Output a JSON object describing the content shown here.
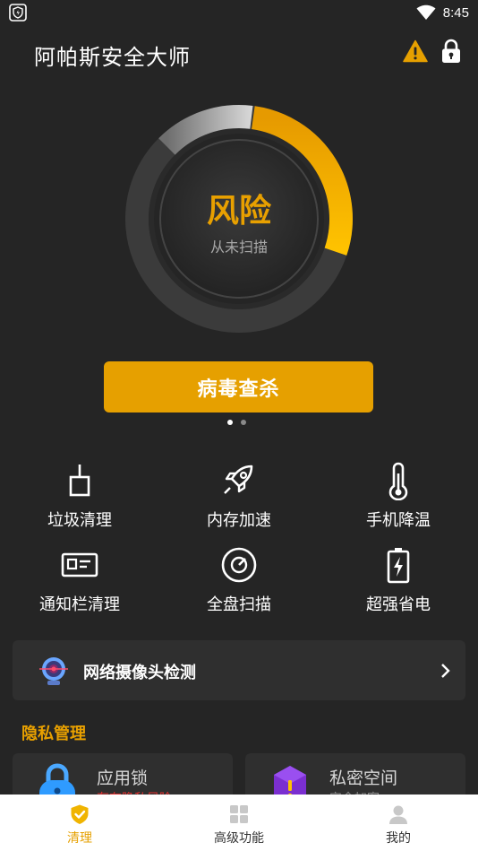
{
  "status_bar": {
    "time": "8:45"
  },
  "header": {
    "title": "阿帕斯安全大师"
  },
  "ring": {
    "status": "风险",
    "subtitle": "从未扫描",
    "risk_fraction": 0.28
  },
  "scan_button": {
    "label": "病毒查杀"
  },
  "features": [
    {
      "label": "垃圾清理",
      "icon": "brush-icon"
    },
    {
      "label": "内存加速",
      "icon": "rocket-icon"
    },
    {
      "label": "手机降温",
      "icon": "thermometer-icon"
    },
    {
      "label": "通知栏清理",
      "icon": "notification-card-icon"
    },
    {
      "label": "全盘扫描",
      "icon": "disk-scan-icon"
    },
    {
      "label": "超强省电",
      "icon": "battery-bolt-icon"
    }
  ],
  "camera_card": {
    "label": "网络摄像头检测"
  },
  "privacy": {
    "section_title": "隐私管理",
    "cards": [
      {
        "title": "应用锁",
        "subtitle": "存在隐私风险"
      },
      {
        "title": "私密空间",
        "subtitle": "安全加密"
      }
    ]
  },
  "bottom_nav": [
    {
      "label": "清理",
      "active": true
    },
    {
      "label": "高级功能",
      "active": false
    },
    {
      "label": "我的",
      "active": false
    }
  ],
  "colors": {
    "accent": "#e6a000",
    "background": "#252525",
    "card": "#2f2f2f",
    "risk": "#e03030"
  }
}
